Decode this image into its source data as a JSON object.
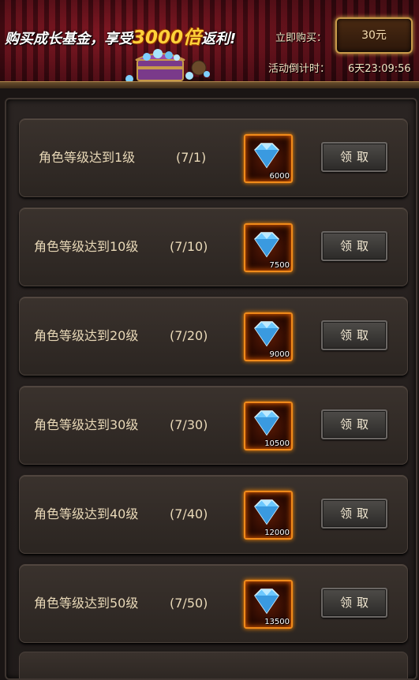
{
  "banner": {
    "slogan_prefix": "购买成长基金，享受",
    "slogan_multiplier": "3000倍",
    "slogan_suffix": "返利!",
    "buy_label": "立即购买：",
    "price": "30元",
    "countdown_label": "活动倒计时：",
    "countdown_value": "6天23:09:56"
  },
  "rewards": [
    {
      "label": "角色等级达到1级",
      "progress": "(7/1)",
      "amount": "6000",
      "button": "领取"
    },
    {
      "label": "角色等级达到10级",
      "progress": "(7/10)",
      "amount": "7500",
      "button": "领取"
    },
    {
      "label": "角色等级达到20级",
      "progress": "(7/20)",
      "amount": "9000",
      "button": "领取"
    },
    {
      "label": "角色等级达到30级",
      "progress": "(7/30)",
      "amount": "10500",
      "button": "领取"
    },
    {
      "label": "角色等级达到40级",
      "progress": "(7/40)",
      "amount": "12000",
      "button": "领取"
    },
    {
      "label": "角色等级达到50级",
      "progress": "(7/50)",
      "amount": "13500",
      "button": "领取"
    }
  ],
  "icons": {
    "reward_icon": "diamond-icon",
    "chest": "treasure-chest-icon"
  },
  "colors": {
    "accent_gold": "#ffd23a",
    "icon_border": "#f08a1a",
    "text": "#e9d9b8"
  }
}
